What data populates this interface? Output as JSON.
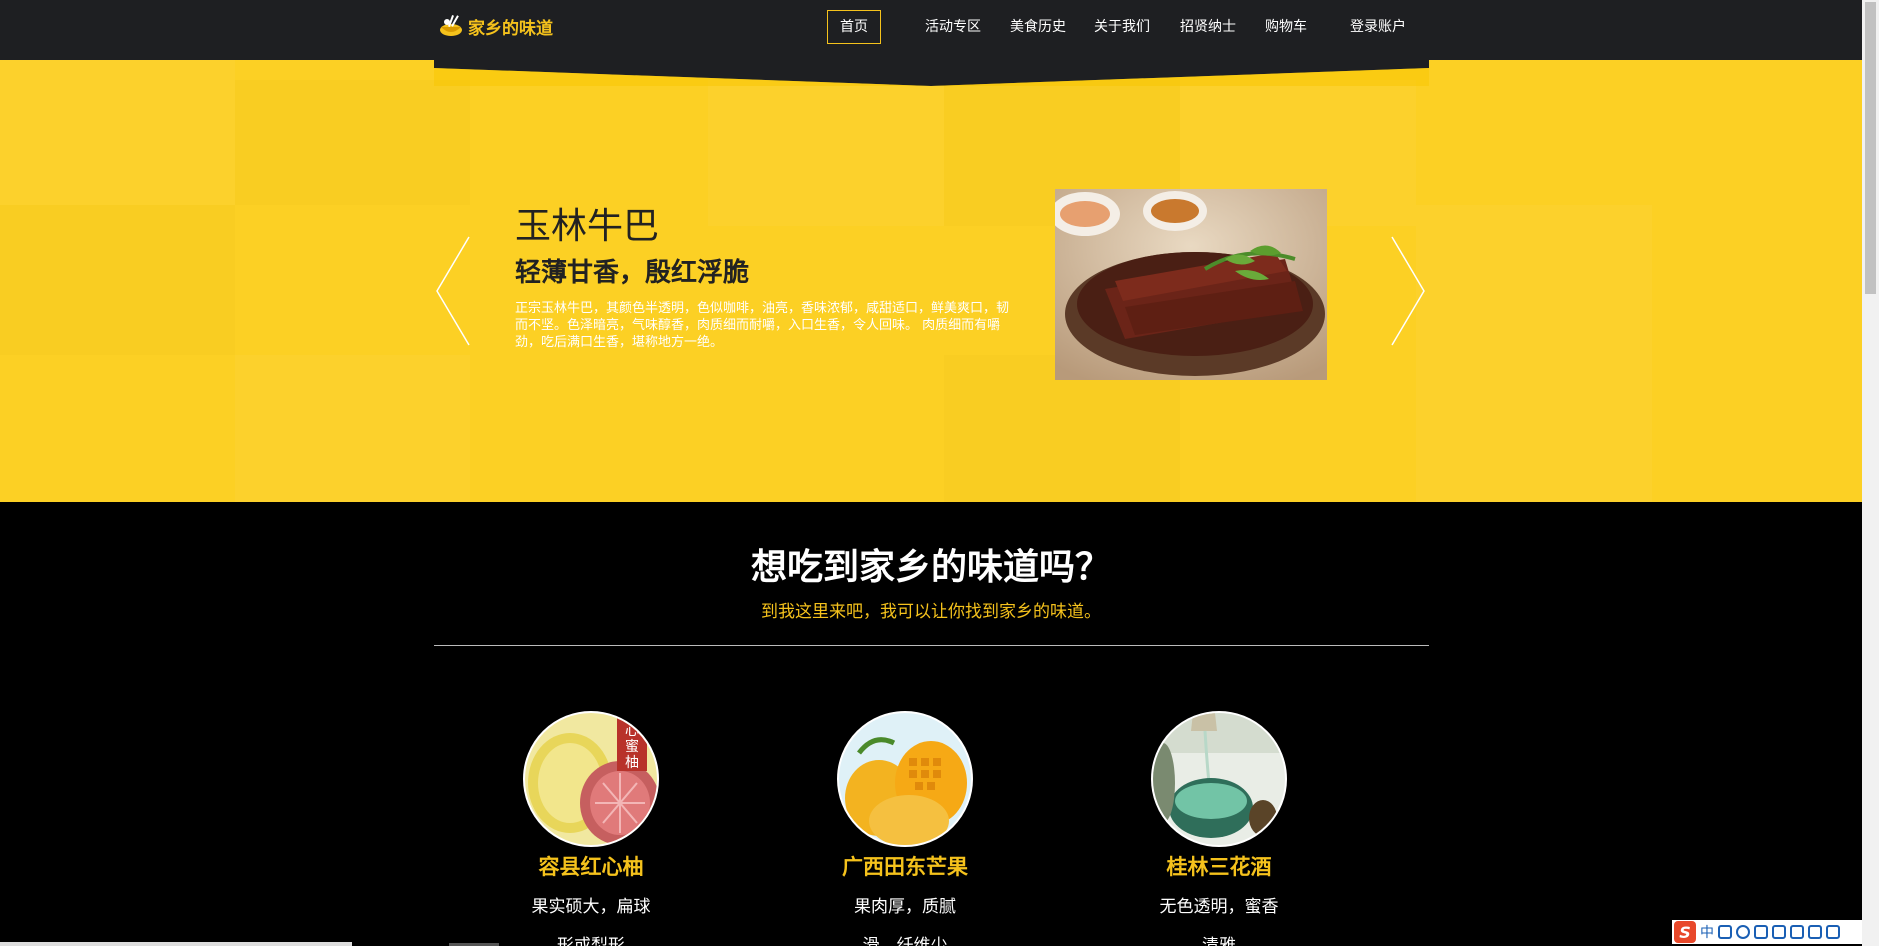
{
  "brand": {
    "name": "家乡的味道"
  },
  "nav": {
    "items": [
      {
        "label": "首页",
        "active": true
      },
      {
        "label": "活动专区",
        "active": false
      },
      {
        "label": "美食历史",
        "active": false
      },
      {
        "label": "关于我们",
        "active": false
      },
      {
        "label": "招贤纳士",
        "active": false
      },
      {
        "label": "购物车",
        "active": false
      },
      {
        "label": "登录账户",
        "active": false
      }
    ]
  },
  "hero": {
    "title": "玉林牛巴",
    "subtitle": "轻薄甘香，殷红浮脆",
    "description": "正宗玉林牛巴，其颜色半透明，色似咖啡，油亮，香味浓郁，咸甜适口，鲜美爽口，韧而不坚。色泽暗亮，气味醇香，肉质细而耐嚼，入口生香，令人回味。 肉质细而有嚼劲，吃后满口生香，堪称地方一绝。",
    "image_alt": "玉林牛巴"
  },
  "intro": {
    "title": "想吃到家乡的味道吗？",
    "subtitle": "到我这里来吧，我可以让你找到家乡的味道。"
  },
  "products": [
    {
      "name": "容县红心柚",
      "line1": "果实硕大，扁球",
      "line2": "形或梨形"
    },
    {
      "name": "广西田东芒果",
      "line1": "果肉厚，质腻",
      "line2": "滑，纤维少"
    },
    {
      "name": "桂林三花酒",
      "line1": "无色透明，蜜香",
      "line2": "清雅"
    }
  ],
  "ime": {
    "lang": "中"
  },
  "colors": {
    "accent": "#f5c21c",
    "hero_bg": "#fcd024",
    "nav_bg": "#1e1f22"
  }
}
